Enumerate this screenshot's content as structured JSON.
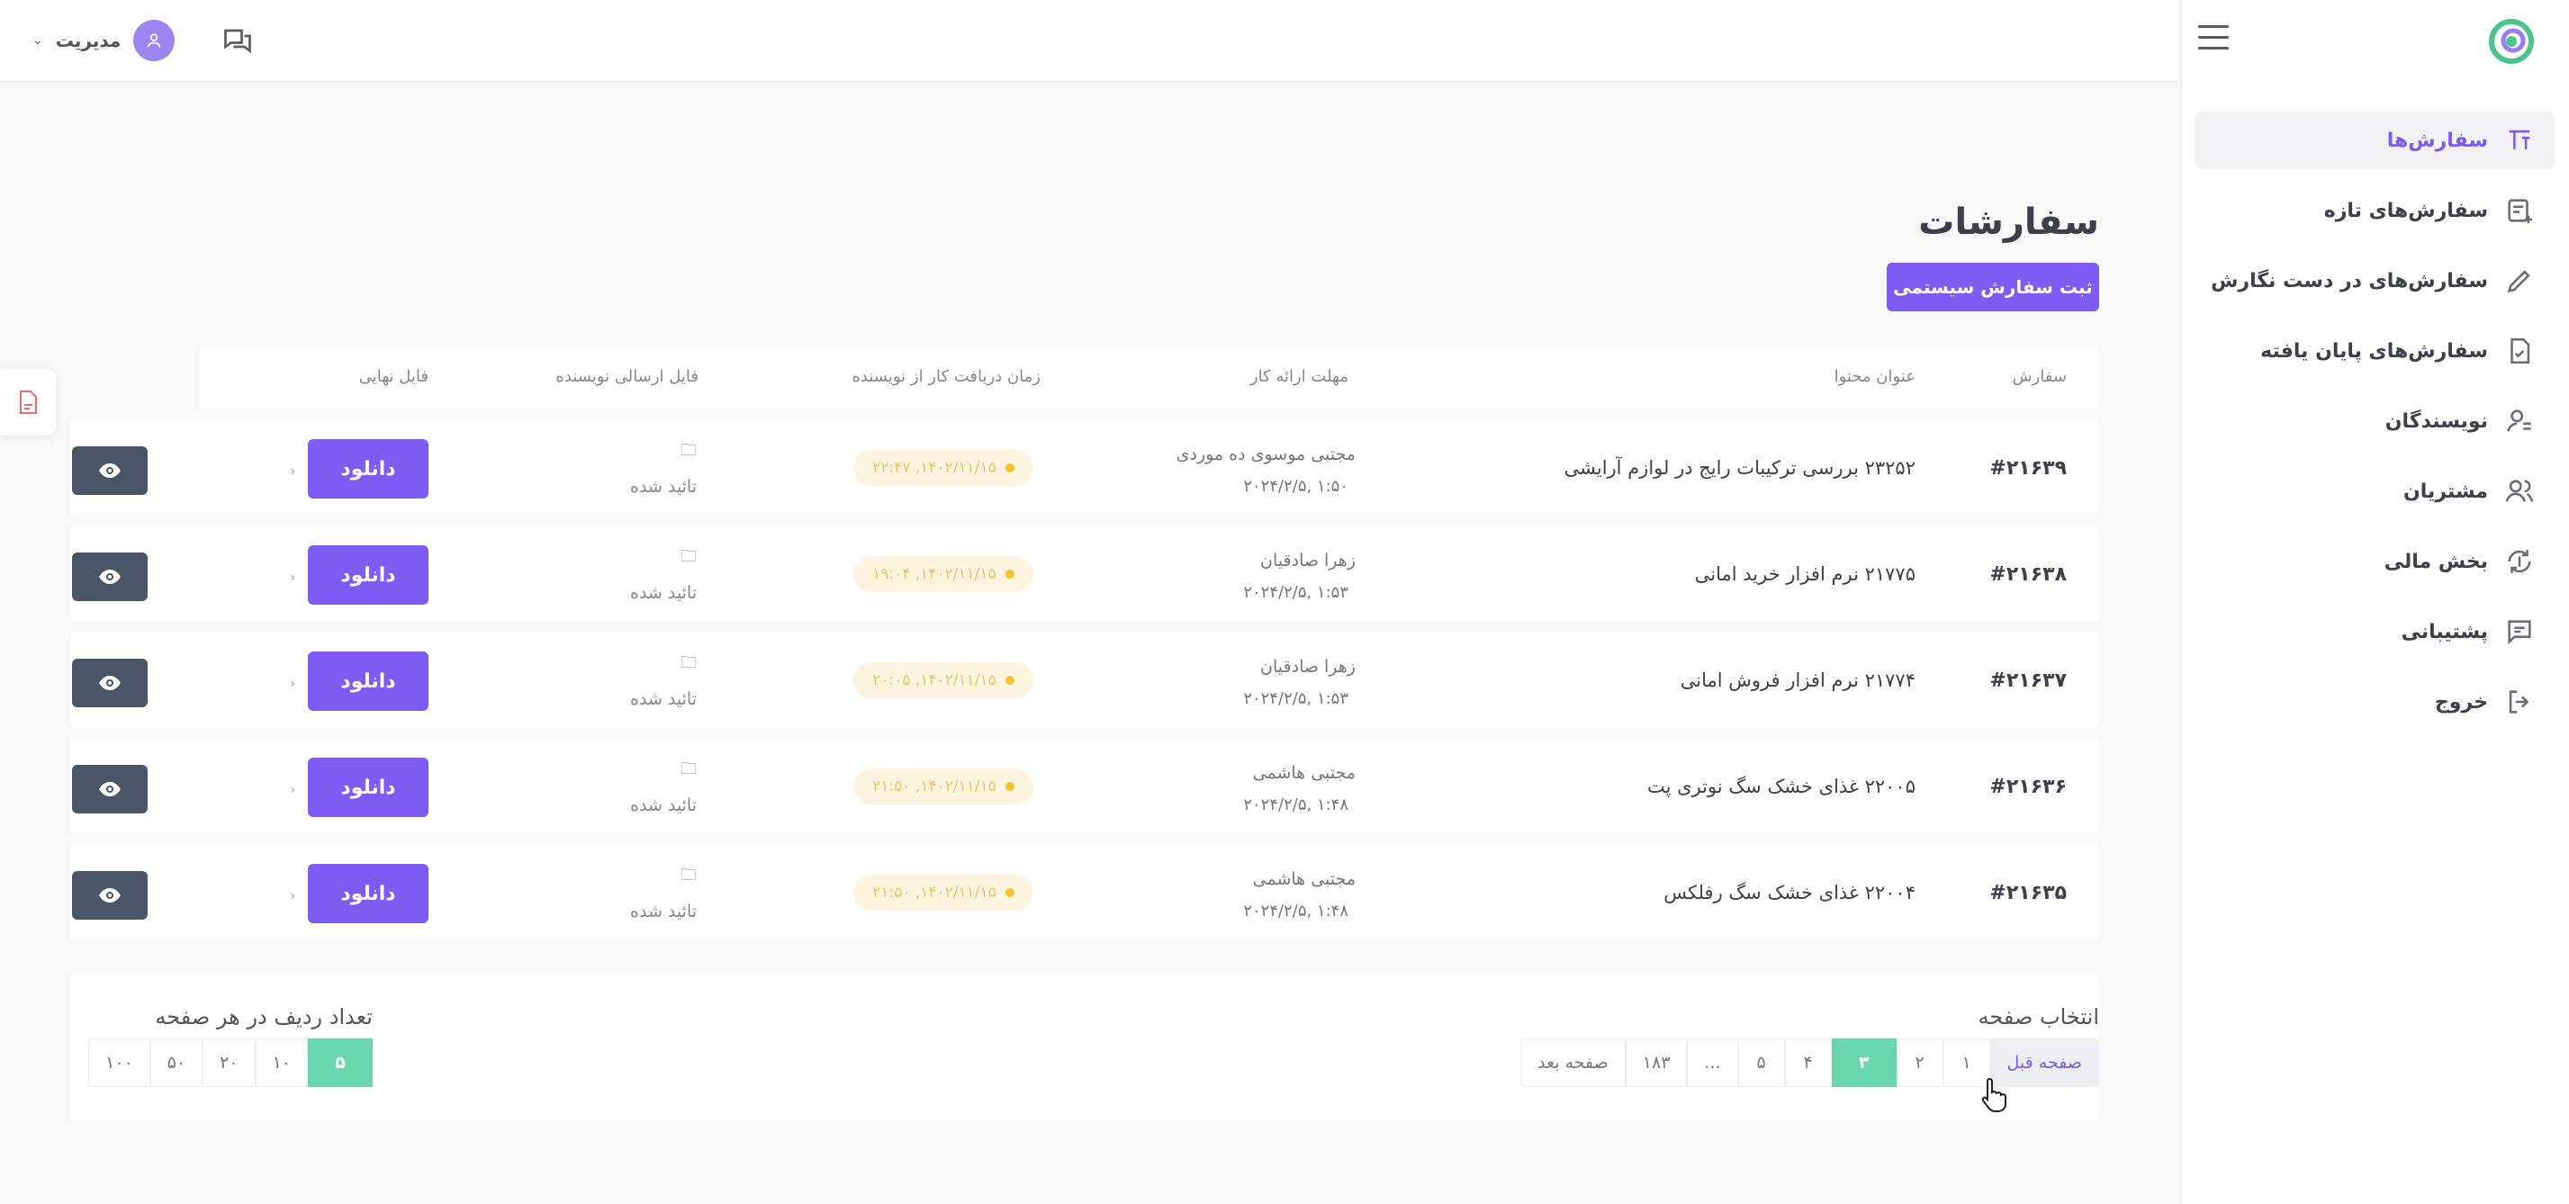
{
  "sidebar": {
    "items": [
      {
        "label": "سفارش‌ها",
        "icon": "orders-icon",
        "active": true
      },
      {
        "label": "سفارش‌های تازه",
        "icon": "new-orders-icon"
      },
      {
        "label": "سفارش‌های در دست نگارش",
        "icon": "pencil-icon"
      },
      {
        "label": "سفارش‌های پایان یافته",
        "icon": "completed-file-icon"
      },
      {
        "label": "نویسندگان",
        "icon": "writers-icon"
      },
      {
        "label": "مشتریان",
        "icon": "customers-icon"
      },
      {
        "label": "بخش مالی",
        "icon": "finance-icon"
      },
      {
        "label": "پشتیبانی",
        "icon": "support-chat-icon"
      },
      {
        "label": "خروج",
        "icon": "logout-icon"
      }
    ]
  },
  "topbar": {
    "user_name": "مدیریت",
    "caret": "⌄"
  },
  "main": {
    "title": "سفارشات",
    "add_button": "ثبت سفارش سیستمی",
    "columns": {
      "order": "سفارش",
      "title": "عنوان محتوا",
      "deadline": "مهلت ارائه کار",
      "received": "زمان دریافت کار از نویسنده",
      "writer_file": "فایل ارسالی نویسنده",
      "final_file": "فایل نهایی"
    },
    "rows": [
      {
        "id": "#۲۱۶۳۹",
        "title": "۲۳۲۵۲ بررسی ترکیبات رایج در لوازم آرایشی",
        "writer": "مجتبی موسوی ده موردی",
        "date": "۲۰۲۴/۲/۵, ۱:۵۰",
        "received": "۱۴۰۲/۱۱/۱۵, ۲۲:۴۷",
        "file_status": "تائید شده",
        "download": "دانلود"
      },
      {
        "id": "#۲۱۶۳۸",
        "title": "۲۱۷۷۵ نرم افزار خرید امانی",
        "writer": "زهرا صادقیان",
        "date": "۲۰۲۴/۲/۵, ۱:۵۳",
        "received": "۱۴۰۲/۱۱/۱۵, ۱۹:۰۴",
        "file_status": "تائید شده",
        "download": "دانلود"
      },
      {
        "id": "#۲۱۶۳۷",
        "title": "۲۱۷۷۴ نرم افزار فروش امانی",
        "writer": "زهرا صادقیان",
        "date": "۲۰۲۴/۲/۵, ۱:۵۳",
        "received": "۱۴۰۲/۱۱/۱۵, ۲۰:۰۵",
        "file_status": "تائید شده",
        "download": "دانلود"
      },
      {
        "id": "#۲۱۶۳۶",
        "title": "۲۲۰۰۵ غذای خشک سگ نوتری پت",
        "writer": "مجتبی هاشمی",
        "date": "۲۰۲۴/۲/۵, ۱:۴۸",
        "received": "۱۴۰۲/۱۱/۱۵, ۲۱:۵۰",
        "file_status": "تائید شده",
        "download": "دانلود"
      },
      {
        "id": "#۲۱۶۳۵",
        "title": "۲۲۰۰۴ غذای خشک سگ رفلکس",
        "writer": "مجتبی هاشمی",
        "date": "۲۰۲۴/۲/۵, ۱:۴۸",
        "received": "۱۴۰۲/۱۱/۱۵, ۲۱:۵۰",
        "file_status": "تائید شده",
        "download": "دانلود"
      }
    ]
  },
  "pagination": {
    "select_label": "انتخاب صفحه",
    "prev": "صفحه قبل",
    "pages": [
      "۱",
      "۲",
      "۳",
      "۴",
      "۵",
      "...",
      "۱۸۳"
    ],
    "active_page": "۳",
    "next": "صفحه بعد",
    "per_page_label": "تعداد ردیف در هر صفحه",
    "per_page_options": [
      "۵",
      "۱۰",
      "۲۰",
      "۵۰",
      "۱۰۰"
    ],
    "per_page_active": "۵"
  },
  "colors": {
    "primary": "#7c5cf3",
    "active_page": "#6ad6b0",
    "view_button": "#4a5568",
    "badge_bg": "#fdf4df"
  }
}
